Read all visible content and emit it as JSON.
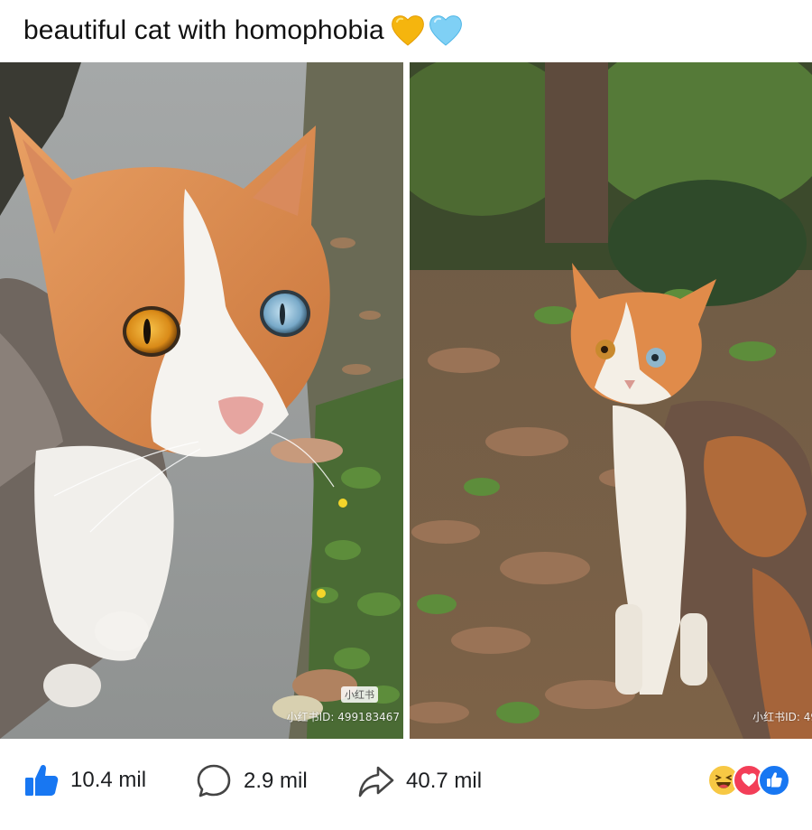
{
  "post": {
    "caption": "beautiful cat with homophobia",
    "caption_emojis": [
      "yellow-heart",
      "light-blue-heart"
    ]
  },
  "photos": {
    "left": {
      "description_icon": "cat-photo-heterochromia-closeup",
      "watermark_badge": "小红书",
      "watermark_id": "小红书ID: 499183467"
    },
    "right": {
      "description_icon": "cat-photo-calico-in-leaves",
      "watermark_id": "小红书ID: 49"
    }
  },
  "actions": {
    "like": {
      "icon": "thumbs-up-icon",
      "count": "10.4 mil",
      "color": "#1877f2"
    },
    "comment": {
      "icon": "comment-bubble-icon",
      "count": "2.9 mil"
    },
    "share": {
      "icon": "share-arrow-icon",
      "count": "40.7 mil"
    }
  },
  "reactions": [
    "haha-emoji",
    "love-heart",
    "like-thumb"
  ],
  "colors": {
    "like_blue": "#1877f2",
    "love_red": "#f33e58",
    "haha_yellow": "#f7c844"
  }
}
